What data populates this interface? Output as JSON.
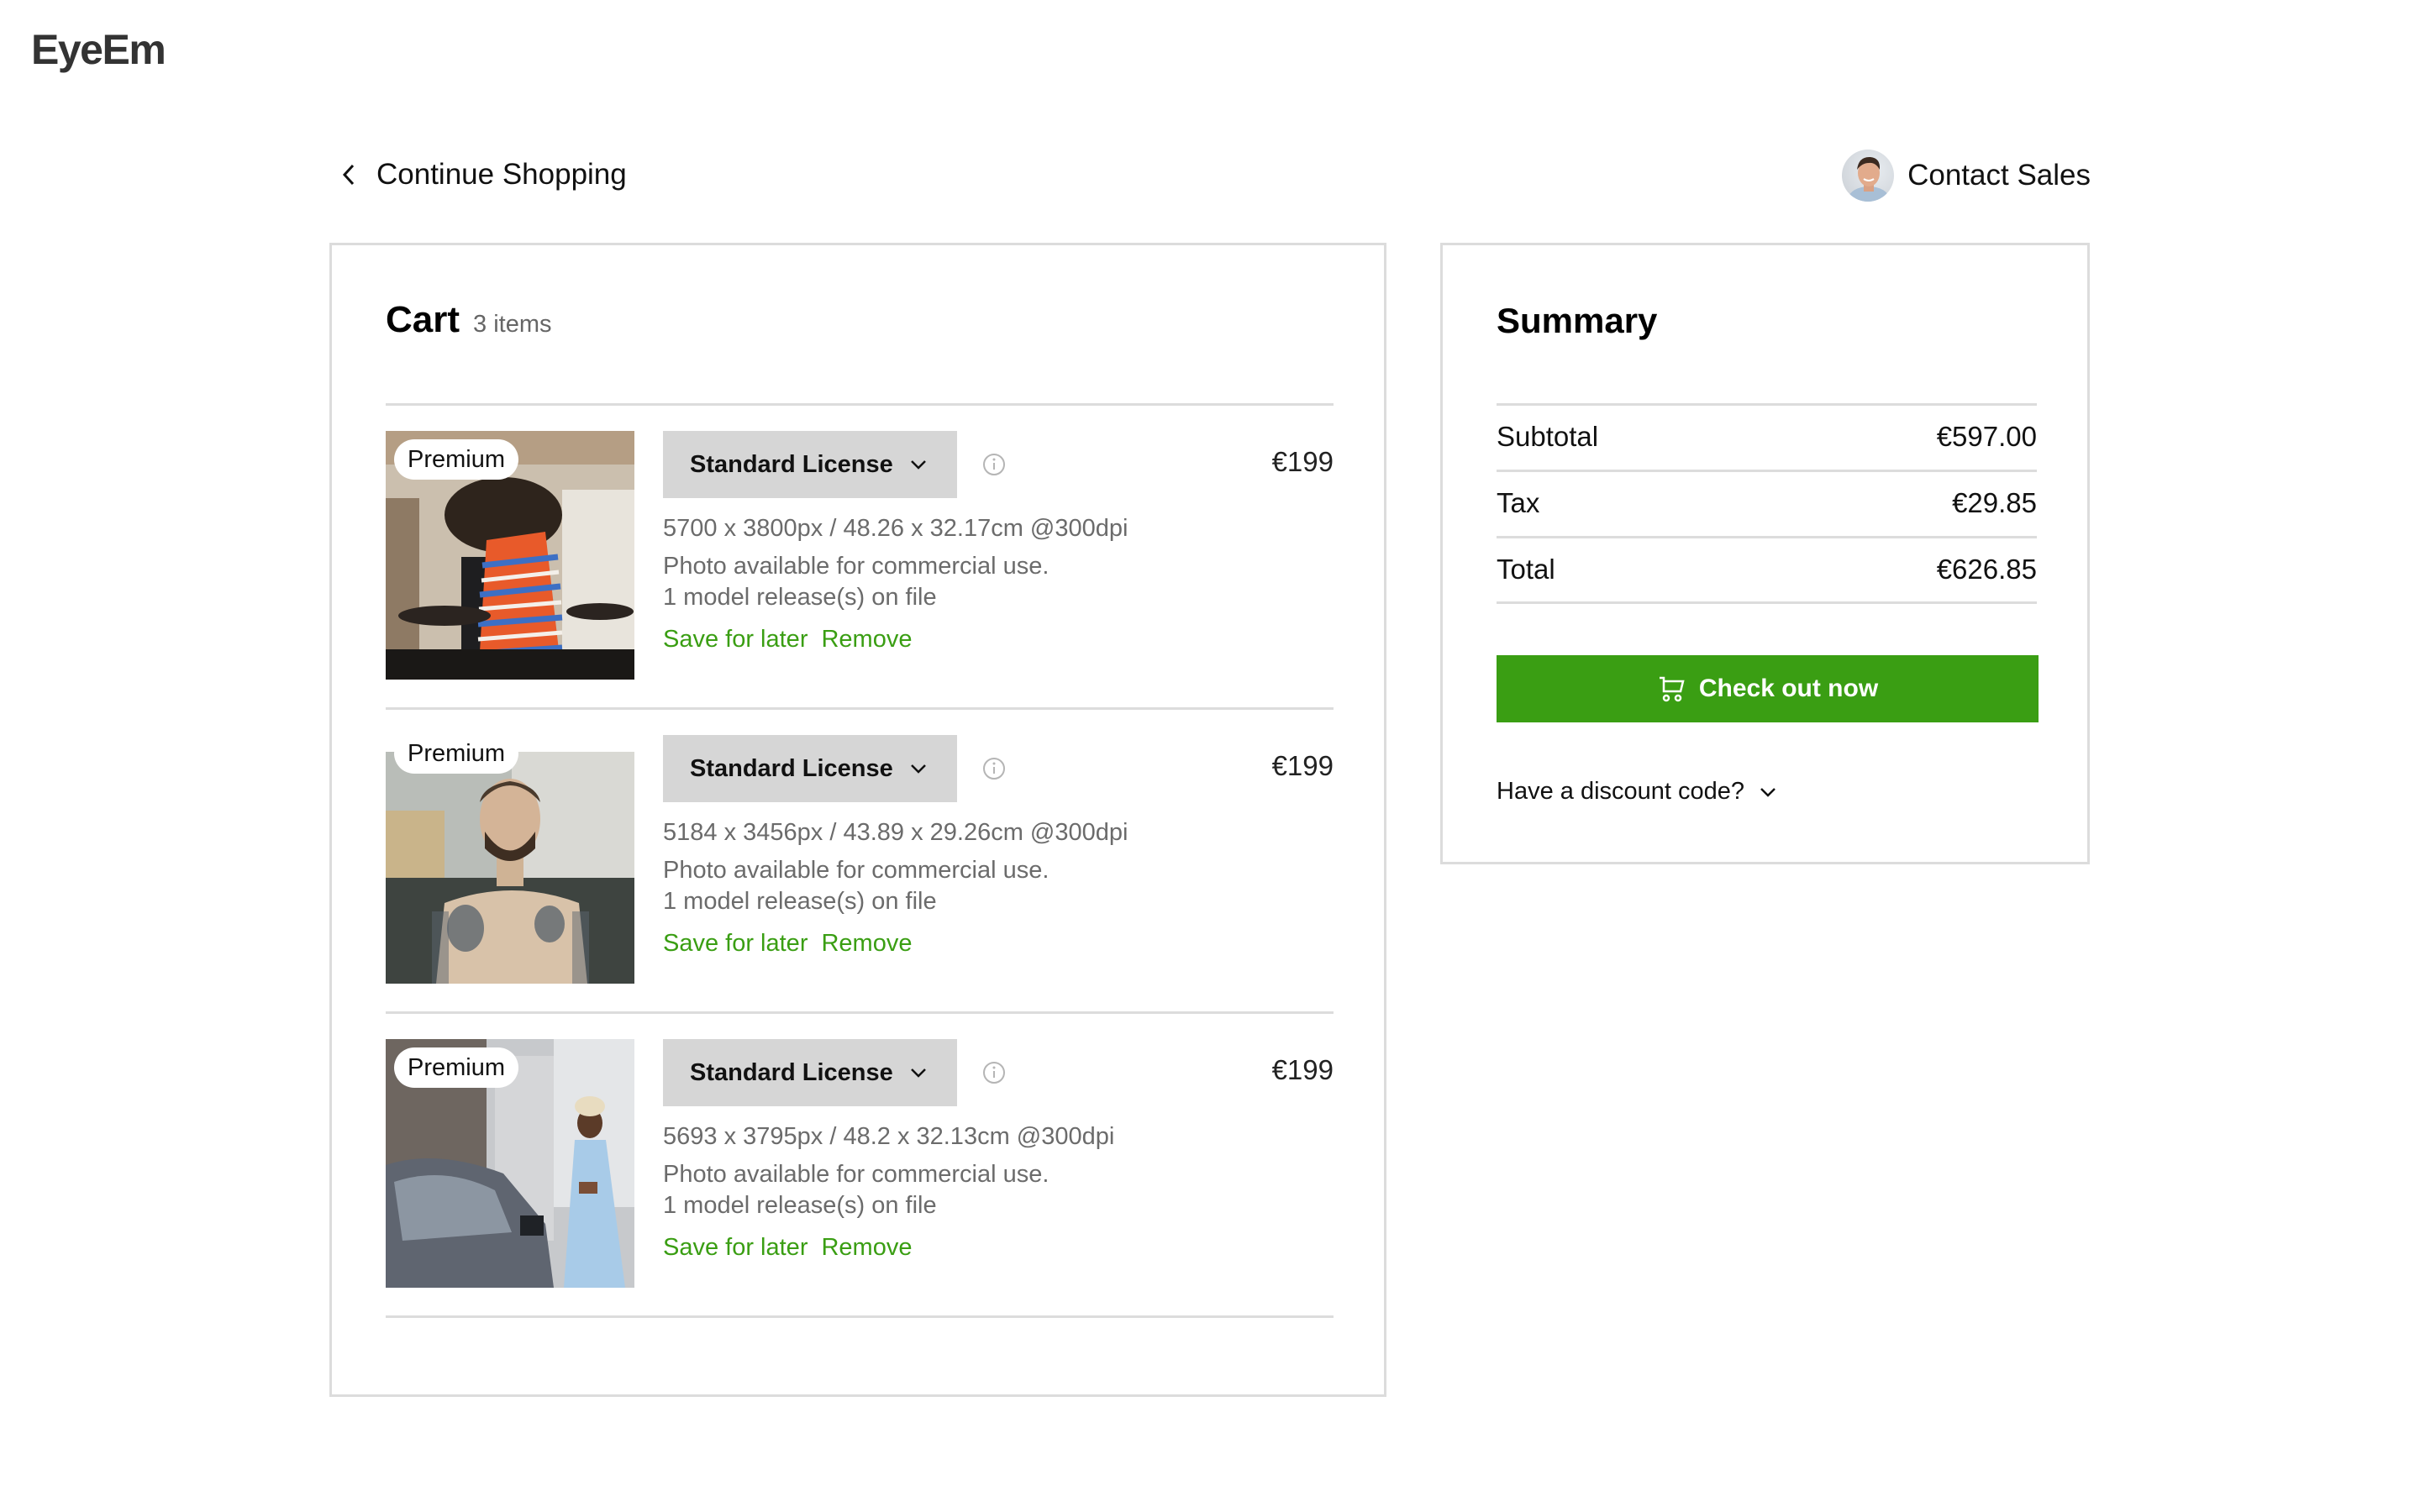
{
  "header": {
    "logo": "EyeEm",
    "back_label": "Continue Shopping",
    "contact_label": "Contact Sales"
  },
  "cart": {
    "title": "Cart",
    "count": "3 items",
    "items": [
      {
        "badge": "Premium",
        "license": "Standard License",
        "price": "€199",
        "dimensions": "5700 x 3800px / 48.26 x 32.17cm @300dpi",
        "usage": "Photo available for commercial use.",
        "releases": "1 model release(s) on file",
        "save_label": "Save for later",
        "remove_label": "Remove",
        "image_desc": "person with curly hair in striped sweater in front of drum kit"
      },
      {
        "badge": "Premium",
        "license": "Standard License",
        "price": "€199",
        "dimensions": "5184 x 3456px / 43.89 x 29.26cm @300dpi",
        "usage": "Photo available for commercial use.",
        "releases": "1 model release(s) on file",
        "save_label": "Save for later",
        "remove_label": "Remove",
        "image_desc": "shirtless tattooed bearded man on rooftop"
      },
      {
        "badge": "Premium",
        "license": "Standard License",
        "price": "€199",
        "dimensions": "5693 x 3795px / 48.2 x 32.13cm @300dpi",
        "usage": "Photo available for commercial use.",
        "releases": "1 model release(s) on file",
        "save_label": "Save for later",
        "remove_label": "Remove",
        "image_desc": "woman in light blue dress looking at phone on city street"
      }
    ]
  },
  "summary": {
    "title": "Summary",
    "rows": [
      {
        "label": "Subtotal",
        "value": "€597.00"
      },
      {
        "label": "Tax",
        "value": "€29.85"
      },
      {
        "label": "Total",
        "value": "€626.85"
      }
    ],
    "checkout_label": "Check out now",
    "discount_label": "Have a discount code?"
  },
  "colors": {
    "accent_green": "#3a9e13",
    "license_bg": "#d6d6d6",
    "border": "#dcdcdc"
  }
}
